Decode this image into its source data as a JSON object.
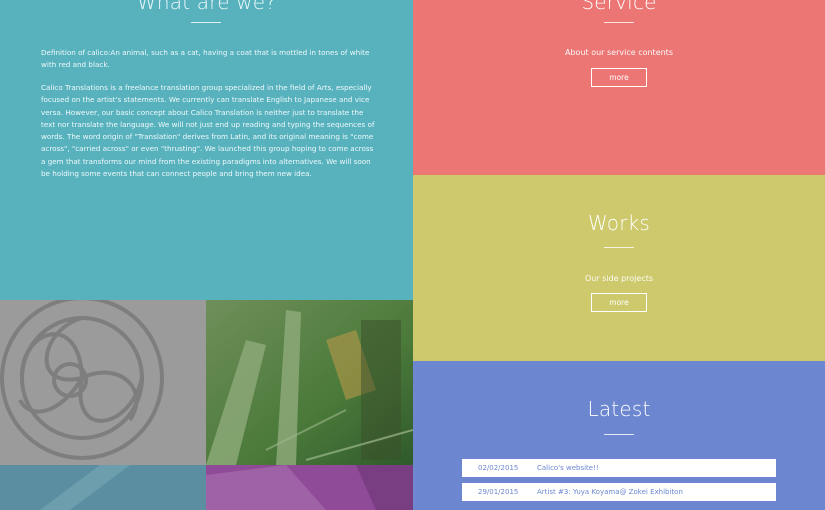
{
  "about": {
    "title": "What are we?",
    "definition": "Definition of calico:An animal, such as a cat, having a coat that is mottled in tones of white with red and black.",
    "body": "Calico Translations is a freelance translation group specialized in the field of Arts, especially focused on the artist's statements. We currently can translate English to Japanese and vice versa. However, our basic concept about Calico Translation is neither just to translate the text nor translate the language. We will not just end up reading and typing the sequences of words. The word origin of \"Translation\" derives from Latin, and its original meaning is \"come across\", \"carried across\" or even \"thrusting\". We launched this group hoping to come across a gem that transforms our mind from the existing paradigms into alternatives. We will soon be holding some events that can connect people and bring them new idea."
  },
  "service": {
    "title": "Service",
    "subtitle": "About our service contents",
    "more_label": "more"
  },
  "works": {
    "title": "Works",
    "subtitle": "Our side projects",
    "more_label": "more"
  },
  "latest": {
    "title": "Latest",
    "items": [
      {
        "date": "02/02/2015",
        "title": "Calico's website!!"
      },
      {
        "date": "29/01/2015",
        "title": "Artist #3: Yuya Koyama@ Zokei Exhibiton"
      }
    ]
  },
  "colors": {
    "about_bg": "#58b2be",
    "service_bg": "#eb7674",
    "works_bg": "#cdc96c",
    "latest_bg": "#6c87d0"
  },
  "icons": {
    "logo": "calico-triskelion-logo"
  }
}
